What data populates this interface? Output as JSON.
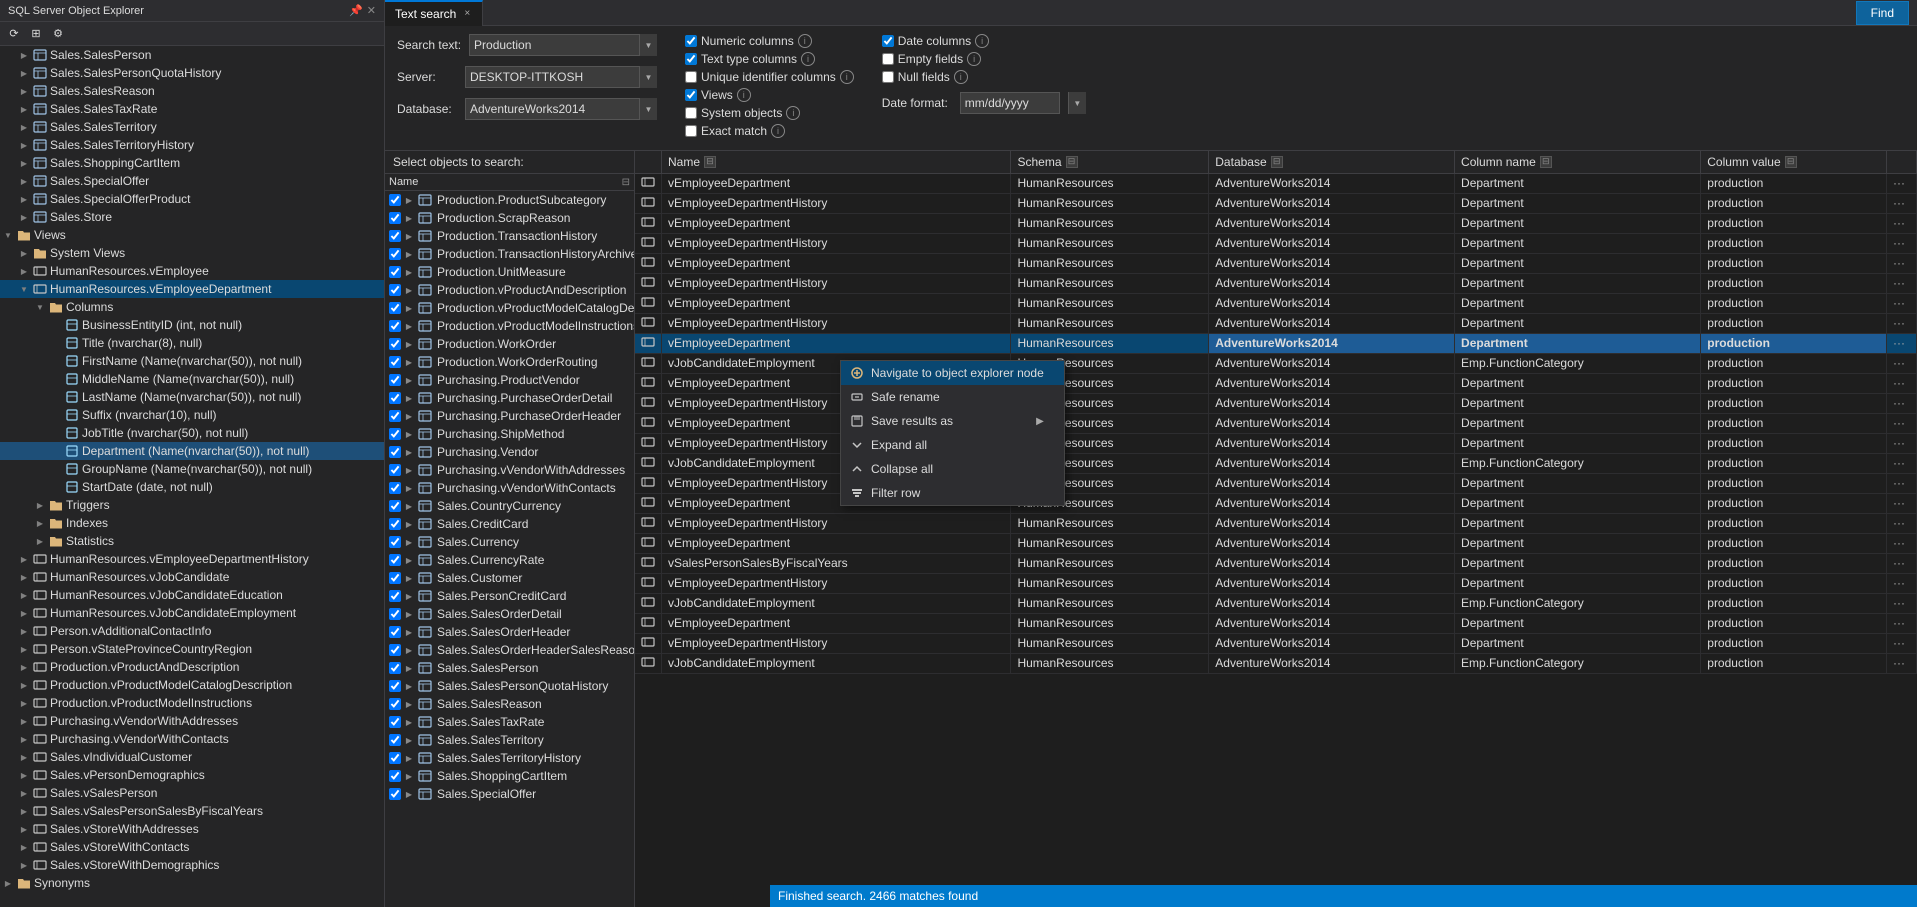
{
  "explorer": {
    "title": "SQL Server Object Explorer",
    "toolbar": {
      "refresh": "⟳",
      "filter": "⊞",
      "settings": "⚙"
    },
    "tree_items": [
      {
        "indent": 1,
        "type": "table",
        "label": "Sales.SalesPerson",
        "expanded": false
      },
      {
        "indent": 1,
        "type": "table",
        "label": "Sales.SalesPersonQuotaHistory",
        "expanded": false
      },
      {
        "indent": 1,
        "type": "table",
        "label": "Sales.SalesReason",
        "expanded": false
      },
      {
        "indent": 1,
        "type": "table",
        "label": "Sales.SalesTaxRate",
        "expanded": false
      },
      {
        "indent": 1,
        "type": "table",
        "label": "Sales.SalesTerritory",
        "expanded": false
      },
      {
        "indent": 1,
        "type": "table",
        "label": "Sales.SalesTerritoryHistory",
        "expanded": false
      },
      {
        "indent": 1,
        "type": "table",
        "label": "Sales.ShoppingCartItem",
        "expanded": false
      },
      {
        "indent": 1,
        "type": "table",
        "label": "Sales.SpecialOffer",
        "expanded": false
      },
      {
        "indent": 1,
        "type": "table",
        "label": "Sales.SpecialOfferProduct",
        "expanded": false
      },
      {
        "indent": 1,
        "type": "table",
        "label": "Sales.Store",
        "expanded": false
      },
      {
        "indent": 0,
        "type": "folder",
        "label": "Views",
        "expanded": true
      },
      {
        "indent": 1,
        "type": "folder",
        "label": "System Views",
        "expanded": false
      },
      {
        "indent": 1,
        "type": "view",
        "label": "HumanResources.vEmployee",
        "expanded": false
      },
      {
        "indent": 1,
        "type": "view",
        "label": "HumanResources.vEmployeeDepartment",
        "expanded": true,
        "selected": true
      },
      {
        "indent": 2,
        "type": "folder",
        "label": "Columns",
        "expanded": true
      },
      {
        "indent": 3,
        "type": "column",
        "label": "BusinessEntityID (int, not null)"
      },
      {
        "indent": 3,
        "type": "column",
        "label": "Title (nvarchar(8), null)"
      },
      {
        "indent": 3,
        "type": "column",
        "label": "FirstName (Name(nvarchar(50)), not null)"
      },
      {
        "indent": 3,
        "type": "column",
        "label": "MiddleName (Name(nvarchar(50)), null)"
      },
      {
        "indent": 3,
        "type": "column",
        "label": "LastName (Name(nvarchar(50)), not null)"
      },
      {
        "indent": 3,
        "type": "column",
        "label": "Suffix (nvarchar(10), null)"
      },
      {
        "indent": 3,
        "type": "column",
        "label": "JobTitle (nvarchar(50), not null)"
      },
      {
        "indent": 3,
        "type": "column",
        "label": "Department (Name(nvarchar(50)), not null)",
        "highlighted": true
      },
      {
        "indent": 3,
        "type": "column",
        "label": "GroupName (Name(nvarchar(50)), not null)"
      },
      {
        "indent": 3,
        "type": "column",
        "label": "StartDate (date, not null)"
      },
      {
        "indent": 2,
        "type": "folder",
        "label": "Triggers",
        "expanded": false
      },
      {
        "indent": 2,
        "type": "folder",
        "label": "Indexes",
        "expanded": false
      },
      {
        "indent": 2,
        "type": "folder",
        "label": "Statistics",
        "expanded": false
      },
      {
        "indent": 1,
        "type": "view",
        "label": "HumanResources.vEmployeeDepartmentHistory",
        "expanded": false
      },
      {
        "indent": 1,
        "type": "view",
        "label": "HumanResources.vJobCandidate",
        "expanded": false
      },
      {
        "indent": 1,
        "type": "view",
        "label": "HumanResources.vJobCandidateEducation",
        "expanded": false
      },
      {
        "indent": 1,
        "type": "view",
        "label": "HumanResources.vJobCandidateEmployment",
        "expanded": false
      },
      {
        "indent": 1,
        "type": "view",
        "label": "Person.vAdditionalContactInfo",
        "expanded": false
      },
      {
        "indent": 1,
        "type": "view",
        "label": "Person.vStateProvinceCountryRegion",
        "expanded": false
      },
      {
        "indent": 1,
        "type": "view",
        "label": "Production.vProductAndDescription",
        "expanded": false
      },
      {
        "indent": 1,
        "type": "view",
        "label": "Production.vProductModelCatalogDescription",
        "expanded": false
      },
      {
        "indent": 1,
        "type": "view",
        "label": "Production.vProductModelInstructions",
        "expanded": false
      },
      {
        "indent": 1,
        "type": "view",
        "label": "Purchasing.vVendorWithAddresses",
        "expanded": false
      },
      {
        "indent": 1,
        "type": "view",
        "label": "Purchasing.vVendorWithContacts",
        "expanded": false
      },
      {
        "indent": 1,
        "type": "view",
        "label": "Sales.vIndividualCustomer",
        "expanded": false
      },
      {
        "indent": 1,
        "type": "view",
        "label": "Sales.vPersonDemographics",
        "expanded": false
      },
      {
        "indent": 1,
        "type": "view",
        "label": "Sales.vSalesPerson",
        "expanded": false
      },
      {
        "indent": 1,
        "type": "view",
        "label": "Sales.vSalesPersonSalesByFiscalYears",
        "expanded": false
      },
      {
        "indent": 1,
        "type": "view",
        "label": "Sales.vStoreWithAddresses",
        "expanded": false
      },
      {
        "indent": 1,
        "type": "view",
        "label": "Sales.vStoreWithContacts",
        "expanded": false
      },
      {
        "indent": 1,
        "type": "view",
        "label": "Sales.vStoreWithDemographics",
        "expanded": false
      },
      {
        "indent": 0,
        "type": "folder",
        "label": "Synonyms",
        "expanded": false
      }
    ]
  },
  "tab": {
    "label": "Text search",
    "active": true,
    "close": "×"
  },
  "search": {
    "search_text_label": "Search text:",
    "search_value": "Production",
    "server_label": "Server:",
    "server_value": "DESKTOP-ITTKOSH",
    "database_label": "Database:",
    "database_value": "AdventureWorks2014",
    "options": {
      "numeric_columns": "Numeric columns",
      "numeric_checked": true,
      "text_type_columns": "Text type columns",
      "text_checked": true,
      "unique_id_columns": "Unique identifier columns",
      "unique_checked": false,
      "views": "Views",
      "views_checked": true,
      "system_objects": "System objects",
      "system_checked": false,
      "exact_match": "Exact match",
      "exact_checked": false,
      "date_columns": "Date columns",
      "date_checked": true,
      "empty_fields": "Empty fields",
      "empty_checked": false,
      "null_fields": "Null fields",
      "null_checked": false,
      "date_format_label": "Date format:",
      "date_format_value": "mm/dd/yyyy"
    },
    "find_label": "Find"
  },
  "objects_section": {
    "header": "Select objects to search:",
    "col_header": "Name",
    "items": [
      "Production.ProductSubcategory",
      "Production.ScrapReason",
      "Production.TransactionHistory",
      "Production.TransactionHistoryArchive",
      "Production.UnitMeasure",
      "Production.vProductAndDescription",
      "Production.vProductModelCatalogDescription",
      "Production.vProductModelInstructions",
      "Production.WorkOrder",
      "Production.WorkOrderRouting",
      "Purchasing.ProductVendor",
      "Purchasing.PurchaseOrderDetail",
      "Purchasing.PurchaseOrderHeader",
      "Purchasing.ShipMethod",
      "Purchasing.Vendor",
      "Purchasing.vVendorWithAddresses",
      "Purchasing.vVendorWithContacts",
      "Sales.CountryCurrency",
      "Sales.CreditCard",
      "Sales.Currency",
      "Sales.CurrencyRate",
      "Sales.Customer",
      "Sales.PersonCreditCard",
      "Sales.SalesOrderDetail",
      "Sales.SalesOrderHeader",
      "Sales.SalesOrderHeaderSalesReason",
      "Sales.SalesPerson",
      "Sales.SalesPersonQuotaHistory",
      "Sales.SalesReason",
      "Sales.SalesTaxRate",
      "Sales.SalesTerritory",
      "Sales.SalesTerritoryHistory",
      "Sales.ShoppingCartItem",
      "Sales.SpecialOffer"
    ]
  },
  "results": {
    "columns": [
      "Name",
      "Schema",
      "Database",
      "Column name",
      "Column value"
    ],
    "rows": [
      {
        "name": "vEmployeeDepartment",
        "schema": "HumanResources",
        "db": "AdventureWorks2014",
        "col": "Department",
        "val": "production",
        "selected": false
      },
      {
        "name": "vEmployeeDepartmentHistory",
        "schema": "HumanResources",
        "db": "AdventureWorks2014",
        "col": "Department",
        "val": "production",
        "selected": false
      },
      {
        "name": "vEmployeeDepartment",
        "schema": "HumanResources",
        "db": "AdventureWorks2014",
        "col": "Department",
        "val": "production",
        "selected": false
      },
      {
        "name": "vEmployeeDepartmentHistory",
        "schema": "HumanResources",
        "db": "AdventureWorks2014",
        "col": "Department",
        "val": "production",
        "selected": false
      },
      {
        "name": "vEmployeeDepartment",
        "schema": "HumanResources",
        "db": "AdventureWorks2014",
        "col": "Department",
        "val": "production",
        "selected": false
      },
      {
        "name": "vEmployeeDepartmentHistory",
        "schema": "HumanResources",
        "db": "AdventureWorks2014",
        "col": "Department",
        "val": "production",
        "selected": false
      },
      {
        "name": "vEmployeeDepartment",
        "schema": "HumanResources",
        "db": "AdventureWorks2014",
        "col": "Department",
        "val": "production",
        "selected": false
      },
      {
        "name": "vEmployeeDepartmentHistory",
        "schema": "HumanResources",
        "db": "AdventureWorks2014",
        "col": "Department",
        "val": "production",
        "selected": false
      },
      {
        "name": "vEmployeeDepartment",
        "schema": "HumanResources",
        "db": "AdventureWorks2014",
        "col": "Department",
        "val": "production",
        "selected": true
      },
      {
        "name": "vJobCandidateEmployment",
        "schema": "HumanResources",
        "db": "AdventureWorks2014",
        "col": "Emp.FunctionCategory",
        "val": "production",
        "selected": false
      },
      {
        "name": "vEmployeeDepartment",
        "schema": "HumanResources",
        "db": "AdventureWorks2014",
        "col": "Department",
        "val": "production",
        "selected": false
      },
      {
        "name": "vEmployeeDepartmentHistory",
        "schema": "HumanResources",
        "db": "AdventureWorks2014",
        "col": "Department",
        "val": "production",
        "selected": false
      },
      {
        "name": "vEmployeeDepartment",
        "schema": "HumanResources",
        "db": "AdventureWorks2014",
        "col": "Department",
        "val": "production",
        "selected": false
      },
      {
        "name": "vEmployeeDepartmentHistory",
        "schema": "HumanResources",
        "db": "AdventureWorks2014",
        "col": "Department",
        "val": "production",
        "selected": false
      },
      {
        "name": "vJobCandidateEmployment",
        "schema": "HumanResources",
        "db": "AdventureWorks2014",
        "col": "Emp.FunctionCategory",
        "val": "production",
        "selected": false
      },
      {
        "name": "vEmployeeDepartmentHistory",
        "schema": "HumanResources",
        "db": "AdventureWorks2014",
        "col": "Department",
        "val": "production",
        "selected": false
      },
      {
        "name": "vEmployeeDepartment",
        "schema": "HumanResources",
        "db": "AdventureWorks2014",
        "col": "Department",
        "val": "production",
        "selected": false
      },
      {
        "name": "vEmployeeDepartmentHistory",
        "schema": "HumanResources",
        "db": "AdventureWorks2014",
        "col": "Department",
        "val": "production",
        "selected": false
      },
      {
        "name": "vEmployeeDepartment",
        "schema": "HumanResources",
        "db": "AdventureWorks2014",
        "col": "Department",
        "val": "production",
        "selected": false
      },
      {
        "name": "vSalesPersonSalesByFiscalYears",
        "schema": "HumanResources",
        "db": "AdventureWorks2014",
        "col": "Department",
        "val": "production",
        "selected": false
      },
      {
        "name": "vEmployeeDepartmentHistory",
        "schema": "HumanResources",
        "db": "AdventureWorks2014",
        "col": "Department",
        "val": "production",
        "selected": false
      },
      {
        "name": "vJobCandidateEmployment",
        "schema": "HumanResources",
        "db": "AdventureWorks2014",
        "col": "Emp.FunctionCategory",
        "val": "production",
        "selected": false
      },
      {
        "name": "vEmployeeDepartment",
        "schema": "HumanResources",
        "db": "AdventureWorks2014",
        "col": "Department",
        "val": "production",
        "selected": false
      },
      {
        "name": "vEmployeeDepartmentHistory",
        "schema": "HumanResources",
        "db": "AdventureWorks2014",
        "col": "Department",
        "val": "production",
        "selected": false
      },
      {
        "name": "vJobCandidateEmployment",
        "schema": "HumanResources",
        "db": "AdventureWorks2014",
        "col": "Emp.FunctionCategory",
        "val": "production",
        "selected": false
      }
    ]
  },
  "context_menu": {
    "items": [
      {
        "label": "Navigate to object explorer node",
        "icon": "arrow",
        "has_submenu": false
      },
      {
        "label": "Safe rename",
        "icon": "rename",
        "has_submenu": false
      },
      {
        "label": "Save results as",
        "icon": "save",
        "has_submenu": true
      },
      {
        "label": "Expand all",
        "icon": "expand",
        "has_submenu": false
      },
      {
        "label": "Collapse all",
        "icon": "collapse",
        "has_submenu": false
      },
      {
        "label": "Filter row",
        "icon": "filter",
        "has_submenu": false
      }
    ]
  },
  "status_bar": {
    "text": "Finished search. 2466 matches found"
  },
  "colors": {
    "accent": "#007acc",
    "selected": "#094771",
    "background": "#1e1e1e",
    "panel": "#252526",
    "toolbar": "#2d2d30"
  }
}
